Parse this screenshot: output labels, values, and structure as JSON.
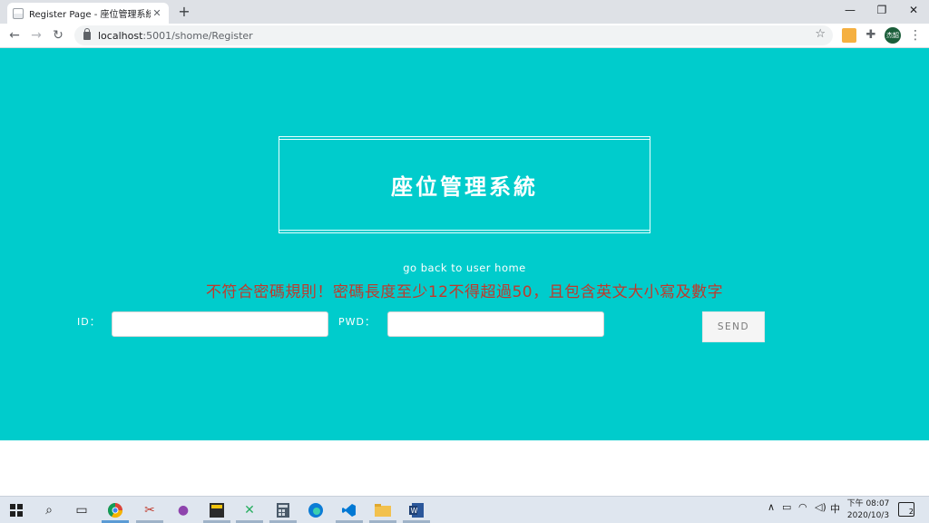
{
  "browser": {
    "tab_title": "Register Page - 座位管理系統",
    "tab_close": "✕",
    "new_tab": "+",
    "url_host": "localhost",
    "url_path": ":5001/shome/Register",
    "avatar_text": "杰韶",
    "window_controls": [
      "—",
      "❐",
      "✕"
    ]
  },
  "page": {
    "title": "座位管理系統",
    "back_link": "go back to user home",
    "error_message": "不符合密碼規則！密碼長度至少12不得超過50，且包含英文大小寫及數字",
    "id_label": "ID：",
    "pwd_label": "PWD：",
    "id_value": "",
    "pwd_value": "",
    "send_label": "SEND",
    "background_color": "#00cccc",
    "error_color": "#c0392b"
  },
  "taskbar": {
    "ime": "中",
    "time": "下午 08:07",
    "date": "2020/10/3",
    "notification_count": "2"
  }
}
